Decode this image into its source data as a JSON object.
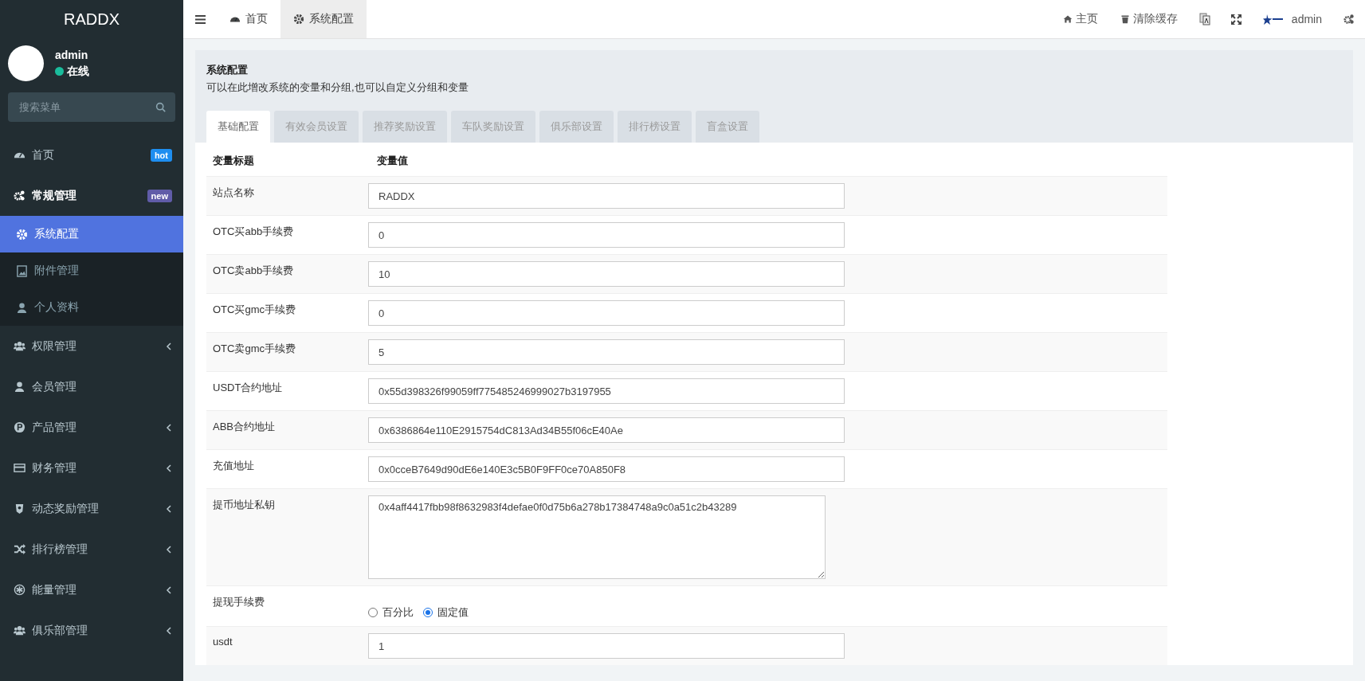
{
  "sidebar": {
    "brand": "RADDX",
    "user": {
      "name": "admin",
      "status": "在线"
    },
    "search": {
      "placeholder": "搜索菜单"
    },
    "items": [
      {
        "label": "首页",
        "kind": "link",
        "selected": false,
        "badge": {
          "text": "hot",
          "color": "#1e8ef0"
        }
      },
      {
        "label": "常规管理",
        "kind": "group",
        "selected": true,
        "expanded": true,
        "badge": {
          "text": "new",
          "color": "#605ca8"
        },
        "children": [
          {
            "label": "系统配置",
            "selected": true
          },
          {
            "label": "附件管理",
            "selected": false
          },
          {
            "label": "个人资料",
            "selected": false
          }
        ]
      },
      {
        "label": "权限管理",
        "kind": "group",
        "selected": false,
        "expanded": false
      },
      {
        "label": "会员管理",
        "kind": "link",
        "selected": false
      },
      {
        "label": "产品管理",
        "kind": "group",
        "selected": false,
        "expanded": false
      },
      {
        "label": "财务管理",
        "kind": "group",
        "selected": false,
        "expanded": false
      },
      {
        "label": "动态奖励管理",
        "kind": "group",
        "selected": false,
        "expanded": false
      },
      {
        "label": "排行榜管理",
        "kind": "group",
        "selected": false,
        "expanded": false
      },
      {
        "label": "能量管理",
        "kind": "group",
        "selected": false,
        "expanded": false
      },
      {
        "label": "俱乐部管理",
        "kind": "group",
        "selected": false,
        "expanded": false
      }
    ]
  },
  "topbar": {
    "tabs": [
      {
        "label": "首页",
        "selected": false
      },
      {
        "label": "系统配置",
        "selected": true
      }
    ],
    "links": [
      {
        "label": "主页"
      },
      {
        "label": "清除缓存"
      }
    ],
    "user": "admin"
  },
  "panel": {
    "title": "系统配置",
    "description": "可以在此增改系统的变量和分组,也可以自定义分组和变量",
    "tabs": [
      {
        "label": "基础配置",
        "selected": true
      },
      {
        "label": "有效会员设置",
        "selected": false
      },
      {
        "label": "推荐奖励设置",
        "selected": false
      },
      {
        "label": "车队奖励设置",
        "selected": false
      },
      {
        "label": "俱乐部设置",
        "selected": false
      },
      {
        "label": "排行榜设置",
        "selected": false
      },
      {
        "label": "盲盒设置",
        "selected": false
      }
    ],
    "columns": [
      "变量标题",
      "变量值"
    ],
    "rows": [
      {
        "kind": "text",
        "label": "站点名称",
        "value": "RADDX"
      },
      {
        "kind": "text",
        "label": "OTC买abb手续费",
        "value": "0"
      },
      {
        "kind": "text",
        "label": "OTC卖abb手续费",
        "value": "10"
      },
      {
        "kind": "text",
        "label": "OTC买gmc手续费",
        "value": "0"
      },
      {
        "kind": "text",
        "label": "OTC卖gmc手续费",
        "value": "5"
      },
      {
        "kind": "text",
        "label": "USDT合约地址",
        "value": "0x55d398326f99059ff775485246999027b3197955"
      },
      {
        "kind": "text",
        "label": "ABB合约地址",
        "value": "0x6386864e110E2915754dC813Ad34B55f06cE40Ae"
      },
      {
        "kind": "text",
        "label": "充值地址",
        "value": "0x0cceB7649d90dE6e140E3c5B0F9FF0ce70A850F8"
      },
      {
        "kind": "textarea",
        "label": "提币地址私钥",
        "value": "0x4aff4417fbb98f8632983f4defae0f0d75b6a278b17384748a9c0a51c2b43289"
      },
      {
        "kind": "radio",
        "label": "提现手续费",
        "options": [
          {
            "label": "百分比",
            "selected": false
          },
          {
            "label": "固定值",
            "selected": true
          }
        ]
      },
      {
        "kind": "text",
        "label": "usdt",
        "value": "1"
      }
    ]
  }
}
